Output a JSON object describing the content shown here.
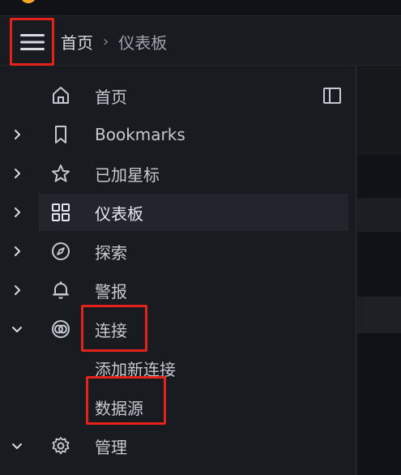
{
  "header": {
    "breadcrumb_home": "首页",
    "breadcrumb_separator": "›",
    "breadcrumb_current": "仪表板"
  },
  "sidebar": {
    "items": [
      {
        "label": "首页",
        "icon": "home-icon"
      },
      {
        "label": "Bookmarks",
        "icon": "bookmark-icon",
        "chevron": "right"
      },
      {
        "label": "已加星标",
        "icon": "star-icon",
        "chevron": "right"
      },
      {
        "label": "仪表板",
        "icon": "apps-icon",
        "chevron": "right",
        "active": true
      },
      {
        "label": "探索",
        "icon": "compass-icon",
        "chevron": "right"
      },
      {
        "label": "警报",
        "icon": "bell-icon",
        "chevron": "right"
      },
      {
        "label": "连接",
        "icon": "connections-icon",
        "chevron": "down"
      },
      {
        "label": "添加新连接",
        "sub": true
      },
      {
        "label": "数据源",
        "sub": true
      },
      {
        "label": "管理",
        "icon": "cog-icon",
        "chevron": "down"
      }
    ]
  },
  "colors": {
    "background": "#181b1f",
    "active_accent": "#ff8833",
    "highlight_box": "#e5231b",
    "text": "#ccccdc"
  }
}
